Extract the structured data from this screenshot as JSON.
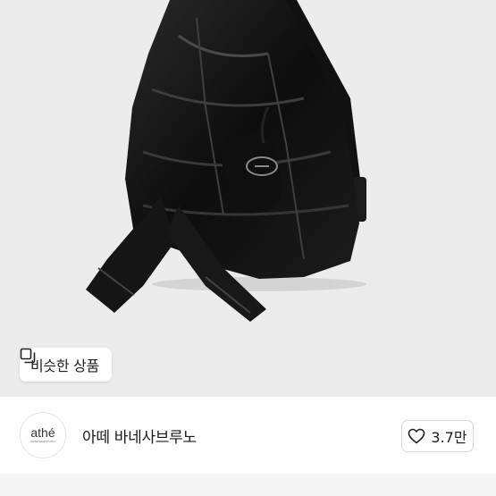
{
  "product_image": {
    "alt_icon": "product-photo"
  },
  "similar_button": {
    "icon": "similar-items-icon",
    "label": "비슷한 상품"
  },
  "brand": {
    "logo_text": "athé",
    "logo_subtext": "vanessabruno",
    "name": "아떼 바네사브루노"
  },
  "like": {
    "icon": "heart-icon",
    "count": "3.7만"
  },
  "colors": {
    "hero_background": "#ececec",
    "bag": "#141414",
    "text": "#1a1a1a"
  }
}
